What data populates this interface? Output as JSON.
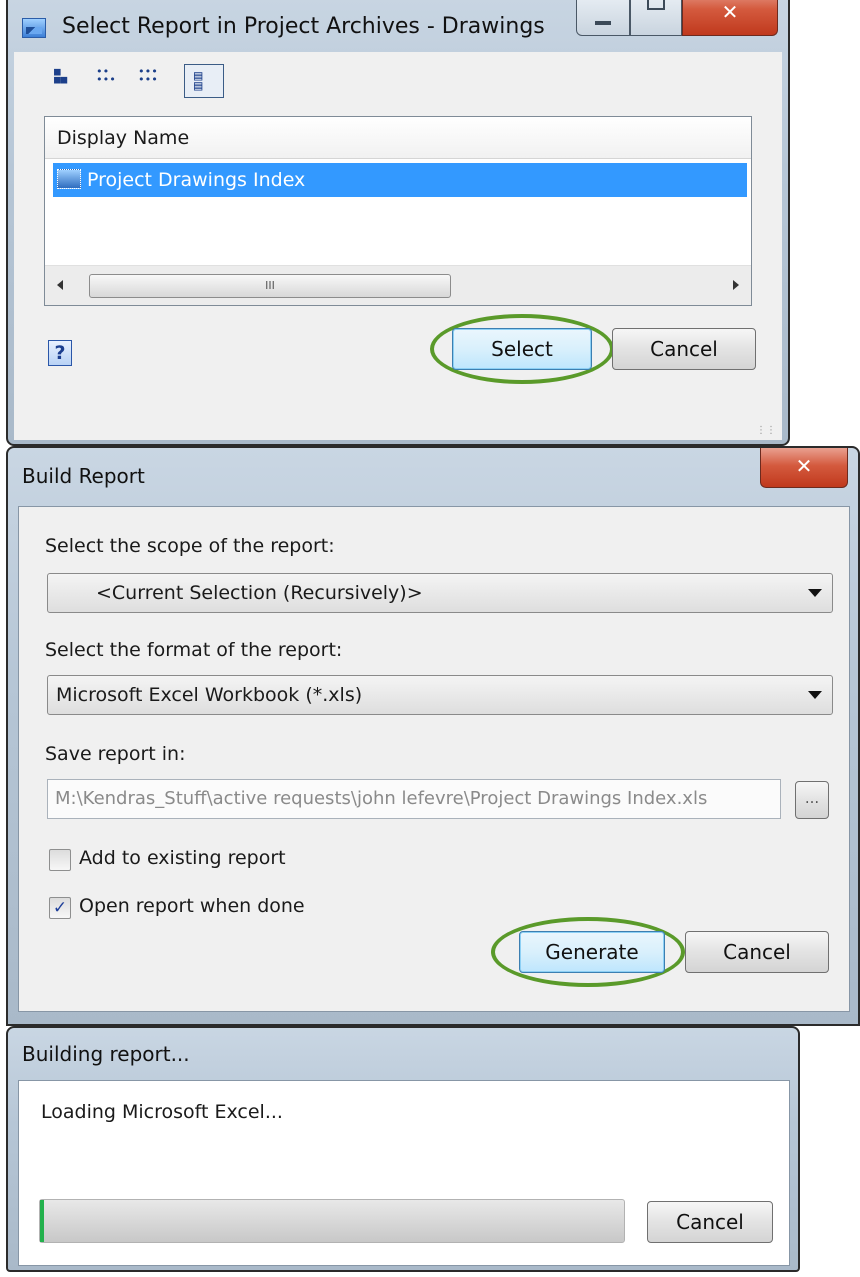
{
  "select_dialog": {
    "title": "Select Report in Project Archives - Drawings",
    "column_header": "Display Name",
    "rows": [
      {
        "label": "Project Drawings Index",
        "selected": true
      }
    ],
    "scrollbar_grip": "III",
    "help_glyph": "?",
    "select_label": "Select",
    "cancel_label": "Cancel",
    "toolbar_icons": [
      "list-view-icon",
      "tree-view-icon",
      "detail-tree-icon",
      "details-view-icon"
    ]
  },
  "build_dialog": {
    "title": "Build Report",
    "scope_label": "Select the scope of the report:",
    "scope_value": "<Current Selection (Recursively)>",
    "format_label": "Select the format of the report:",
    "format_value": "Microsoft Excel Workbook (*.xls)",
    "save_label": "Save report in:",
    "save_path": "M:\\Kendras_Stuff\\active requests\\john lefevre\\Project Drawings Index.xls",
    "browse_label": "...",
    "add_existing_label": "Add to existing report",
    "add_existing_checked": false,
    "open_when_done_label": "Open report when done",
    "open_when_done_checked": true,
    "check_glyph": "✓",
    "generate_label": "Generate",
    "cancel_label": "Cancel"
  },
  "progress_dialog": {
    "title": "Building report...",
    "status": "Loading Microsoft Excel...",
    "progress": 0.005,
    "cancel_label": "Cancel"
  },
  "colors": {
    "selection": "#3399ff",
    "highlight_ring": "#5a9a2a",
    "progress_fill": "#22b14c"
  }
}
